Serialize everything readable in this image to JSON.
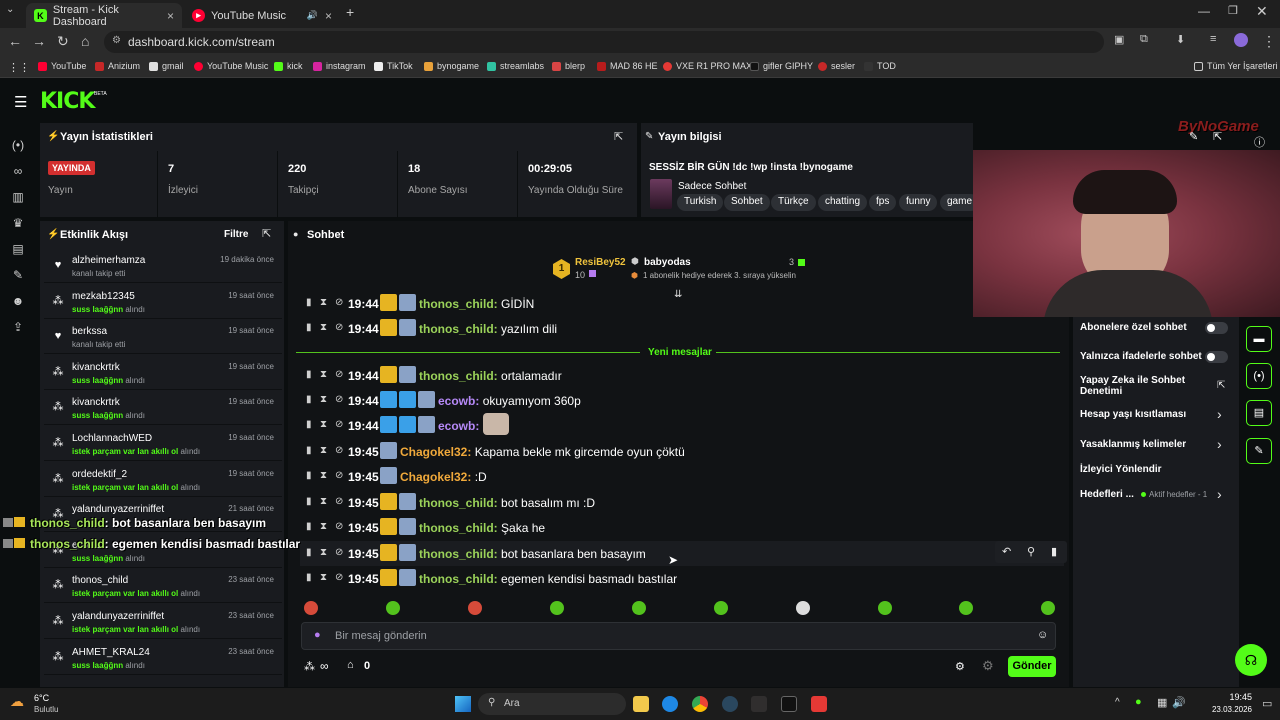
{
  "browser": {
    "tabs": [
      {
        "title": "Stream - Kick Dashboard",
        "active": true
      },
      {
        "title": "YouTube Music",
        "active": false
      }
    ],
    "url": "dashboard.kick.com/stream",
    "bookmarks": [
      "YouTube",
      "Anizium",
      "gmail",
      "YouTube Music",
      "kick",
      "instagram",
      "TikTok",
      "bynogame",
      "streamlabs",
      "blerp",
      "MAD 86 HE",
      "VXE R1 PRO MAX",
      "gifler GIPHY",
      "sesler",
      "TOD"
    ],
    "all_bookmarks": "Tüm Yer İşaretleri"
  },
  "app": {
    "logo": "KICK",
    "logo_tag": "BETA",
    "accent": "#53fc18"
  },
  "stats": {
    "title": "Yayın İstatistikleri",
    "live_badge": "YAYINDA",
    "items": [
      {
        "value": "",
        "label": "Yayın"
      },
      {
        "value": "7",
        "label": "İzleyici"
      },
      {
        "value": "220",
        "label": "Takipçi"
      },
      {
        "value": "18",
        "label": "Abone Sayısı"
      },
      {
        "value": "00:29:05",
        "label": "Yayında Olduğu Süre"
      }
    ]
  },
  "stream_info": {
    "title": "Yayın bilgisi",
    "stream_title": "SESSİZ BİR GÜN !dc !wp !insta !bynogame",
    "category": "Sadece Sohbet",
    "tags": [
      "Turkish",
      "Sohbet",
      "Türkçe",
      "chatting",
      "fps",
      "funny",
      "game"
    ]
  },
  "activity": {
    "title": "Etkinlik Akışı",
    "filter": "Filtre",
    "items": [
      {
        "name": "alzheimerhamza",
        "pre": "",
        "hl": "",
        "post": "kanalı takip etti",
        "time": "19 dakika önce",
        "icon": "heart"
      },
      {
        "name": "mezkab12345",
        "pre": "",
        "hl": "suss laağğnn",
        "post": " alındı",
        "time": "19 saat önce",
        "icon": "redeem"
      },
      {
        "name": "berkssa",
        "pre": "",
        "hl": "",
        "post": "kanalı takip etti",
        "time": "19 saat önce",
        "icon": "heart"
      },
      {
        "name": "kivanckrtrk",
        "pre": "",
        "hl": "suss laağğnn",
        "post": " alındı",
        "time": "19 saat önce",
        "icon": "redeem"
      },
      {
        "name": "kivanckrtrk",
        "pre": "",
        "hl": "suss laağğnn",
        "post": " alındı",
        "time": "19 saat önce",
        "icon": "redeem"
      },
      {
        "name": "LochlannachWED",
        "pre": "",
        "hl": "istek parçam var lan akıllı ol",
        "post": " alındı",
        "time": "19 saat önce",
        "icon": "redeem"
      },
      {
        "name": "ordedektif_2",
        "pre": "",
        "hl": "istek parçam var lan akıllı ol",
        "post": " alındı",
        "time": "19 saat önce",
        "icon": "redeem"
      },
      {
        "name": "yalandunyazerriniffet",
        "pre": "",
        "hl": "",
        "post": "",
        "time": "21 saat önce",
        "icon": "redeem"
      },
      {
        "name": "ecowb",
        "pre": "",
        "hl": "suss laağğnn",
        "post": " alındı",
        "time": "22 saat önce",
        "icon": "redeem"
      },
      {
        "name": "thonos_child",
        "pre": "",
        "hl": "istek parçam var lan akıllı ol",
        "post": " alındı",
        "time": "23 saat önce",
        "icon": "redeem"
      },
      {
        "name": "yalandunyazerriniffet",
        "pre": "",
        "hl": "istek parçam var lan akıllı ol",
        "post": " alındı",
        "time": "23 saat önce",
        "icon": "redeem"
      },
      {
        "name": "AHMET_KRAL24",
        "pre": "",
        "hl": "suss laağğnn",
        "post": " alındı",
        "time": "23 saat önce",
        "icon": "redeem"
      }
    ]
  },
  "chat": {
    "title": "Sohbet",
    "leader1_name": "ResiBey52",
    "leader1_count": "10",
    "leader2_name": "babyodas",
    "leader2_count": "3",
    "leader_note": "1 abonelik hediye ederek 3. sıraya yükselin",
    "new_messages": "Yeni mesajlar",
    "messages": [
      {
        "time": "19:44",
        "user": "thonos_child",
        "text": "GİDİN",
        "color": "green"
      },
      {
        "time": "19:44",
        "user": "thonos_child",
        "text": "yazılım dili",
        "color": "green"
      },
      {
        "time": "19:44",
        "user": "thonos_child",
        "text": "ortalamadır",
        "color": "green"
      },
      {
        "time": "19:44",
        "user": "ecowb",
        "text": "okuyamıyom 360p",
        "color": "purple"
      },
      {
        "time": "19:44",
        "user": "ecowb",
        "text": "",
        "color": "purple"
      },
      {
        "time": "19:45",
        "user": "Chagokel32",
        "text": "Kapama bekle mk gircemde oyun çöktü",
        "color": "orange"
      },
      {
        "time": "19:45",
        "user": "Chagokel32",
        "text": ":D",
        "color": "orange"
      },
      {
        "time": "19:45",
        "user": "thonos_child",
        "text": "bot basalım mı :D",
        "color": "green"
      },
      {
        "time": "19:45",
        "user": "thonos_child",
        "text": "Şaka he",
        "color": "green"
      },
      {
        "time": "19:45",
        "user": "thonos_child",
        "text": "bot basanlara ben basayım",
        "color": "green"
      },
      {
        "time": "19:45",
        "user": "thonos_child",
        "text": "egemen kendisi basmadı bastılar",
        "color": "green"
      }
    ],
    "input_placeholder": "Bir mesaj gönderin",
    "points": "∞",
    "shop_count": "0",
    "send": "Gönder"
  },
  "settings": {
    "items": [
      "Abonelere özel sohbet",
      "Yalnızca ifadelerle sohbet",
      "Yapay Zeka ile Sohbet Denetimi",
      "Hesap yaşı kısıtlaması",
      "Yasaklanmış kelimeler",
      "İzleyici Yönlendir",
      "Hedefleri ..."
    ],
    "goal_status": "Aktif hedefler - 1"
  },
  "overlay": {
    "lines": [
      {
        "user": "thonos_child",
        "text": ": bot basanlara ben basayım"
      },
      {
        "user": "thonos_child",
        "text": ": egemen kendisi basmadı bastılar"
      }
    ],
    "brand": "ByNoGame"
  },
  "taskbar": {
    "temp": "6°C",
    "weather": "Bulutlu",
    "search": "Ara",
    "time": "19:45",
    "date": "23.03.2026"
  }
}
